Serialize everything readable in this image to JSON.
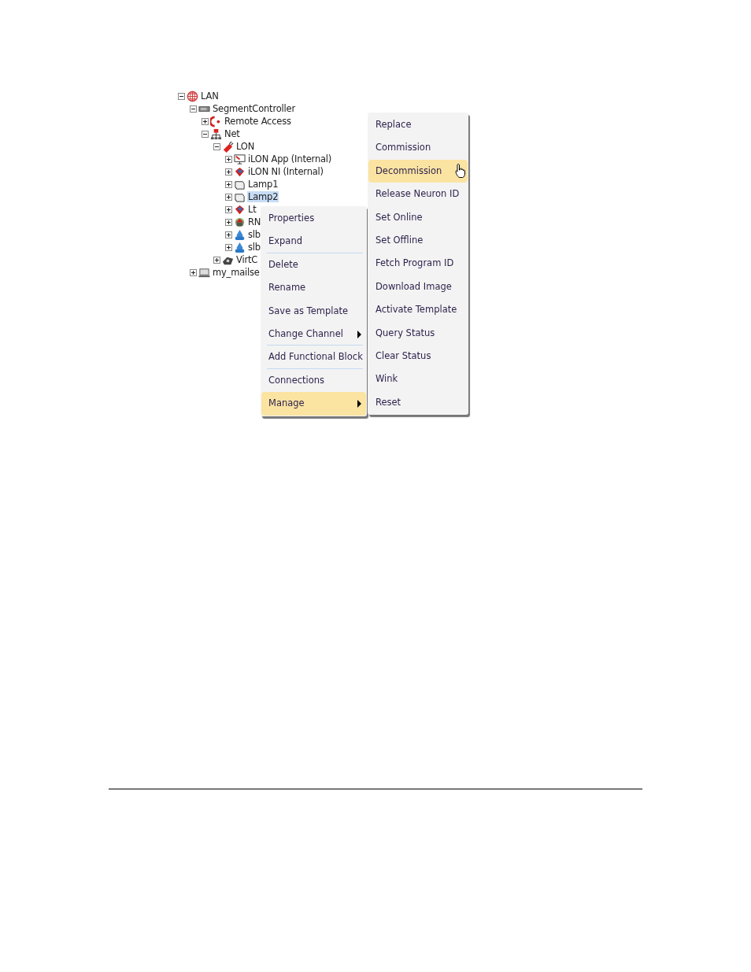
{
  "tree": [
    {
      "label": "LAN",
      "kind": "lan",
      "expanded": true,
      "selected": false,
      "children": [
        {
          "label": "SegmentController",
          "kind": "controller",
          "expanded": true,
          "selected": false,
          "children": [
            {
              "label": "Remote Access",
              "kind": "remote",
              "expanded": false,
              "selected": false
            },
            {
              "label": "Net",
              "kind": "net",
              "expanded": true,
              "selected": false,
              "children": [
                {
                  "label": "LON",
                  "kind": "channel",
                  "expanded": true,
                  "selected": false,
                  "children": [
                    {
                      "label": "iLON App (Internal)",
                      "kind": "app",
                      "expanded": false,
                      "selected": false
                    },
                    {
                      "label": "iLON NI (Internal)",
                      "kind": "ni",
                      "expanded": false,
                      "selected": false
                    },
                    {
                      "label": "Lamp1",
                      "kind": "lamp",
                      "expanded": false,
                      "selected": false
                    },
                    {
                      "label": "Lamp2",
                      "kind": "lamp",
                      "expanded": false,
                      "selected": true
                    },
                    {
                      "label": "Lt",
                      "kind": "ni",
                      "expanded": false,
                      "selected": false
                    },
                    {
                      "label": "RN",
                      "kind": "router",
                      "expanded": false,
                      "selected": false
                    },
                    {
                      "label": "slb",
                      "kind": "drop",
                      "expanded": false,
                      "selected": false
                    },
                    {
                      "label": "slb",
                      "kind": "drop",
                      "expanded": false,
                      "selected": false
                    }
                  ]
                },
                {
                  "label": "VirtC",
                  "kind": "virtual",
                  "expanded": false,
                  "selected": false
                }
              ]
            }
          ]
        },
        {
          "label": "my_mailse",
          "kind": "computer",
          "expanded": false,
          "selected": false
        }
      ]
    }
  ],
  "context_menu": [
    {
      "label": "Properties",
      "selected": false,
      "submenu": false,
      "divider_after": false
    },
    {
      "label": "Expand",
      "selected": false,
      "submenu": false,
      "divider_after": true
    },
    {
      "label": "Delete",
      "selected": false,
      "submenu": false,
      "divider_after": false
    },
    {
      "label": "Rename",
      "selected": false,
      "submenu": false,
      "divider_after": false
    },
    {
      "label": "Save as Template",
      "selected": false,
      "submenu": false,
      "divider_after": false
    },
    {
      "label": "Change Channel",
      "selected": false,
      "submenu": true,
      "divider_after": true
    },
    {
      "label": "Add Functional Block",
      "selected": false,
      "submenu": false,
      "divider_after": true
    },
    {
      "label": "Connections",
      "selected": false,
      "submenu": false,
      "divider_after": false
    },
    {
      "label": "Manage",
      "selected": true,
      "submenu": true,
      "divider_after": false
    }
  ],
  "manage_submenu": [
    {
      "label": "Replace",
      "selected": false
    },
    {
      "label": "Commission",
      "selected": false
    },
    {
      "label": "Decommission",
      "selected": true
    },
    {
      "label": "Release Neuron ID",
      "selected": false
    },
    {
      "label": "Set Online",
      "selected": false
    },
    {
      "label": "Set Offline",
      "selected": false
    },
    {
      "label": "Fetch Program ID",
      "selected": false
    },
    {
      "label": "Download Image",
      "selected": false
    },
    {
      "label": "Activate Template",
      "selected": false
    },
    {
      "label": "Query Status",
      "selected": false
    },
    {
      "label": "Clear Status",
      "selected": false
    },
    {
      "label": "Wink",
      "selected": false
    },
    {
      "label": "Reset",
      "selected": false
    }
  ]
}
